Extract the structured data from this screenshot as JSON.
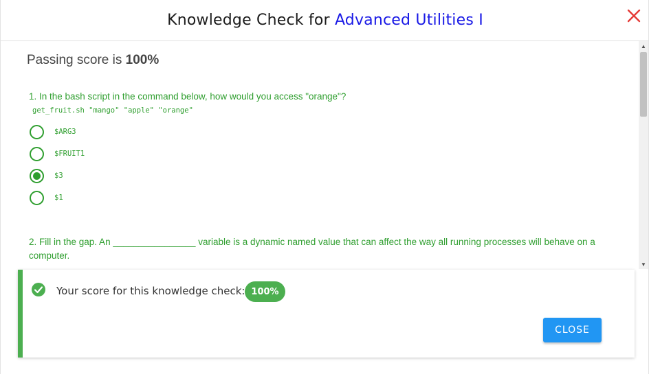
{
  "header": {
    "title_prefix": "Knowledge Check for ",
    "course_name": "Advanced Utilities I",
    "close_icon": "close-x-icon",
    "close_color": "#e53935"
  },
  "passing": {
    "label": "Passing score is ",
    "value": "100%"
  },
  "questions": [
    {
      "text": "1. In the bash script in the command below, how would you access \"orange\"?",
      "code": "get_fruit.sh \"mango\" \"apple\" \"orange\"",
      "options": [
        {
          "label": "$ARG3",
          "selected": false
        },
        {
          "label": "$FRUIT1",
          "selected": false
        },
        {
          "label": "$3",
          "selected": true
        },
        {
          "label": "$1",
          "selected": false
        }
      ]
    },
    {
      "text": "2. Fill in the gap. An ________________ variable is a dynamic named value that can affect the way all running processes will behave on a computer."
    }
  ],
  "result": {
    "icon": "check-circle-icon",
    "message": "Your score for this knowledge check:",
    "score": "100%",
    "close_label": "CLOSE"
  },
  "colors": {
    "accent_green": "#2e9e2e",
    "success": "#4caf50",
    "button_blue": "#2196f3",
    "course_blue": "#1a1ae6"
  }
}
